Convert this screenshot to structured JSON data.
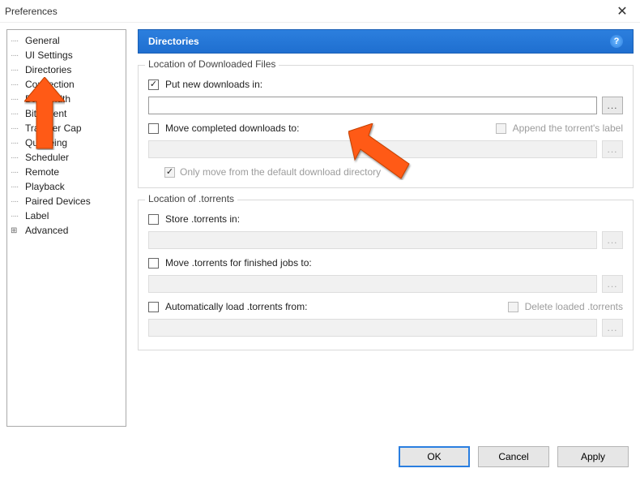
{
  "window": {
    "title": "Preferences"
  },
  "sidebar": {
    "items": [
      {
        "label": "General"
      },
      {
        "label": "UI Settings"
      },
      {
        "label": "Directories"
      },
      {
        "label": "Connection"
      },
      {
        "label": "Bandwidth"
      },
      {
        "label": "BitTorrent"
      },
      {
        "label": "Transfer Cap"
      },
      {
        "label": "Queueing"
      },
      {
        "label": "Scheduler"
      },
      {
        "label": "Remote"
      },
      {
        "label": "Playback"
      },
      {
        "label": "Paired Devices"
      },
      {
        "label": "Label"
      },
      {
        "label": "Advanced",
        "expandable": true
      }
    ]
  },
  "header": {
    "title": "Directories"
  },
  "group1": {
    "legend": "Location of Downloaded Files",
    "putNew": {
      "label": "Put new downloads in:",
      "checked": true,
      "value": ""
    },
    "moveCompleted": {
      "label": "Move completed downloads to:",
      "checked": false,
      "value": ""
    },
    "appendLabel": {
      "label": "Append the torrent's label",
      "checked": false
    },
    "onlyMoveDefault": {
      "label": "Only move from the default download directory",
      "checked": true
    }
  },
  "group2": {
    "legend": "Location of .torrents",
    "storeTorrents": {
      "label": "Store .torrents in:",
      "checked": false,
      "value": ""
    },
    "moveFinished": {
      "label": "Move .torrents for finished jobs to:",
      "checked": false,
      "value": ""
    },
    "autoLoad": {
      "label": "Automatically load .torrents from:",
      "checked": false,
      "value": ""
    },
    "deleteLoaded": {
      "label": "Delete loaded .torrents",
      "checked": false
    }
  },
  "buttons": {
    "ok": "OK",
    "cancel": "Cancel",
    "apply": "Apply"
  },
  "browse": "..."
}
